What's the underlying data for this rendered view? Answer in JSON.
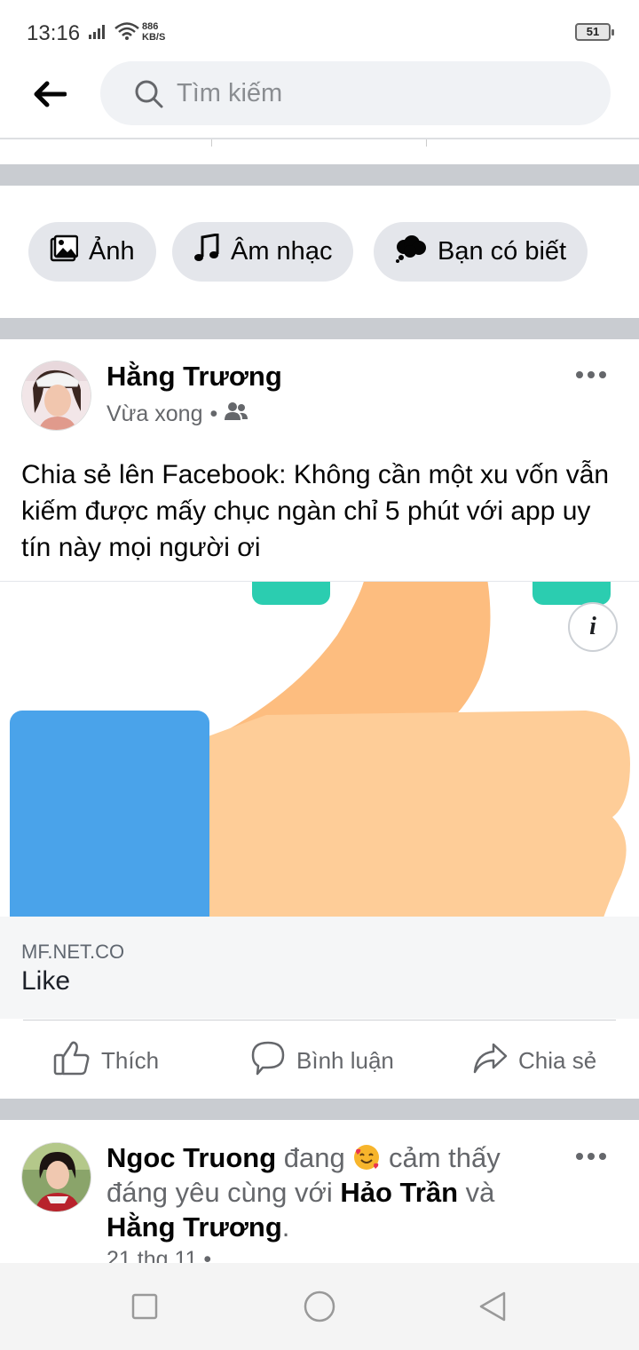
{
  "status": {
    "time": "13:16",
    "speed_value": "886",
    "speed_unit": "KB/S",
    "battery": "51"
  },
  "search": {
    "placeholder": "Tìm kiếm"
  },
  "filters": [
    {
      "label": "Ảnh",
      "icon": "photo-icon"
    },
    {
      "label": "Âm nhạc",
      "icon": "music-note-icon"
    },
    {
      "label": "Bạn có biết",
      "icon": "thought-bubble-icon"
    }
  ],
  "post1": {
    "author": "Hằng Trương",
    "time": "Vừa xong",
    "separator": "•",
    "audience_icon": "friends-icon",
    "text": "Chia sẻ lên Facebook: Không cần một xu vốn vẫn kiếm được mấy chục ngàn chỉ 5 phút với app uy tín này mọi người ơi",
    "link_domain": "MF.NET.CO",
    "link_title": "Like",
    "info_label": "i"
  },
  "actions": {
    "like": "Thích",
    "comment": "Bình luận",
    "share": "Chia sẻ"
  },
  "post2": {
    "author": "Ngoc Truong",
    "verb": "đang",
    "feeling": "cảm thấy đáng yêu cùng với",
    "tag1": "Hảo Trần",
    "conj": "và",
    "tag2": "Hằng Trương",
    "period": ".",
    "meta": "21 thg 11 •"
  },
  "colors": {
    "chip_bg": "#e4e6eb",
    "separator": "#c9ccd1",
    "teal": "#2bcdb0",
    "blue": "#4aa3ea",
    "hand": "#fecd98",
    "thumb": "#fdbd7f"
  }
}
